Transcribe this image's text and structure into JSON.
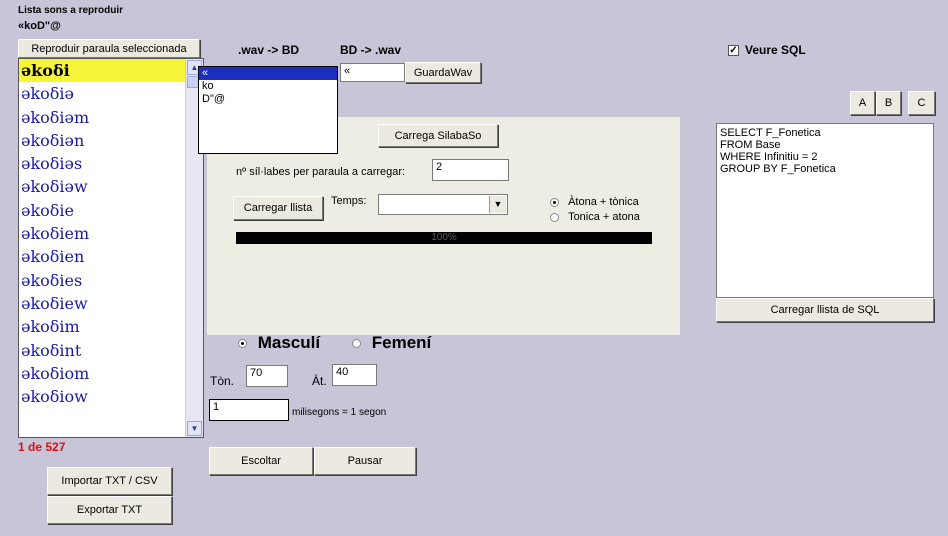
{
  "header": {
    "title": "Lista sons a reproduir",
    "current_word": "«koD\"@"
  },
  "list": {
    "reproduce_button": "Reproduir paraula seleccionada",
    "items": [
      "əkoδi",
      "əkoδiə",
      "əkoδiəm",
      "əkoδiən",
      "əkoδiəs",
      "əkoδiəw",
      "əkoδie",
      "əkoδiem",
      "əkoδien",
      "əkoδies",
      "əkoδiew",
      "əkoδim",
      "əkoδint",
      "əkoδiom",
      "əkoδiow"
    ],
    "selected_index": 0,
    "counter": "1 de 527",
    "import_button": "Importar TXT / CSV",
    "export_button": "Exportar TXT"
  },
  "dropdown": {
    "items": [
      "«",
      "ko",
      "D\"@"
    ],
    "selected_index": 0
  },
  "wav": {
    "wav_to_bd_label": ".wav -> BD",
    "bd_to_wav_label": "BD -> .wav",
    "input_value": "«",
    "save_button": "GuardaWav"
  },
  "panel": {
    "load_syllable_button": "Carrega SilabaSo",
    "syllables_label": "nº síl·labes per paraula a carregar:",
    "syllables_value": "2",
    "load_list_button": "Carregar llista",
    "tense_label": "Temps:",
    "tense_value": "",
    "stress_options": [
      "Àtona + tònica",
      "Tonica + atona"
    ],
    "stress_selected": 0,
    "progress_text": "100%",
    "progress": 1.0
  },
  "voice": {
    "options": [
      "Masculí",
      "Femení"
    ],
    "selected": 0,
    "tone_label": "Tòn.",
    "tone_value": "70",
    "height_label": "Àt.",
    "height_value": "40",
    "ms_value": "1",
    "ms_label": "milisegons = 1 segon",
    "listen_button": "Escoltar",
    "pause_button": "Pausar"
  },
  "sql": {
    "show_sql_label": "Veure SQL",
    "show_sql_checked": true,
    "abc_buttons": [
      "A",
      "B",
      "C"
    ],
    "query_lines": [
      "SELECT F_Fonetica",
      "FROM Base",
      "WHERE Infinitiu = 2",
      "GROUP BY F_Fonetica"
    ],
    "load_button": "Carregar llista de SQL"
  },
  "colors": {
    "background": "#c8c5d8",
    "selection": "#f7f53a",
    "list_text": "#1a1aa0",
    "counter": "#e01010"
  }
}
